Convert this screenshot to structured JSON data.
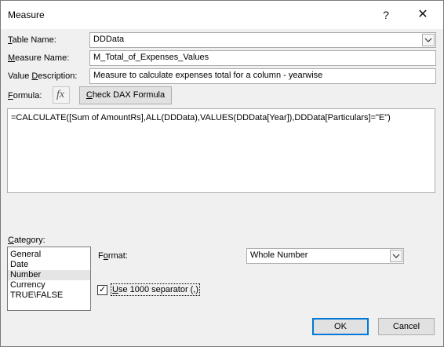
{
  "window": {
    "title": "Measure",
    "help_glyph": "?",
    "close_glyph": "✕"
  },
  "table_name": {
    "label_accel": "T",
    "label_rest": "able Name:",
    "value": "DDData"
  },
  "measure_name": {
    "label_accel": "M",
    "label_rest": "easure Name:",
    "value": "M_Total_of_Expenses_Values"
  },
  "value_description": {
    "label_pre": "Value ",
    "label_accel": "D",
    "label_rest": "escription:",
    "value": "Measure to calculate expenses total for a column - yearwise"
  },
  "formula": {
    "label_accel": "F",
    "label_rest": "ormula:",
    "fx_glyph": "fx",
    "check_button_accel": "C",
    "check_button_rest": "heck DAX Formula",
    "text": "=CALCULATE([Sum of AmountRs],ALL(DDData),VALUES(DDData[Year]),DDData[Particulars]=\"E\")"
  },
  "category": {
    "label_accel": "C",
    "label_rest": "ategory:",
    "items": [
      "General",
      "Date",
      "Number",
      "Currency",
      "TRUE\\FALSE"
    ],
    "selected": "Number"
  },
  "format": {
    "label_pre": "F",
    "label_accel": "o",
    "label_rest": "rmat:",
    "value": "Whole Number"
  },
  "separator": {
    "label_accel": "U",
    "label_rest": "se 1000 separator (,)",
    "checked": true,
    "check_glyph": "✓"
  },
  "buttons": {
    "ok": "OK",
    "cancel": "Cancel"
  }
}
